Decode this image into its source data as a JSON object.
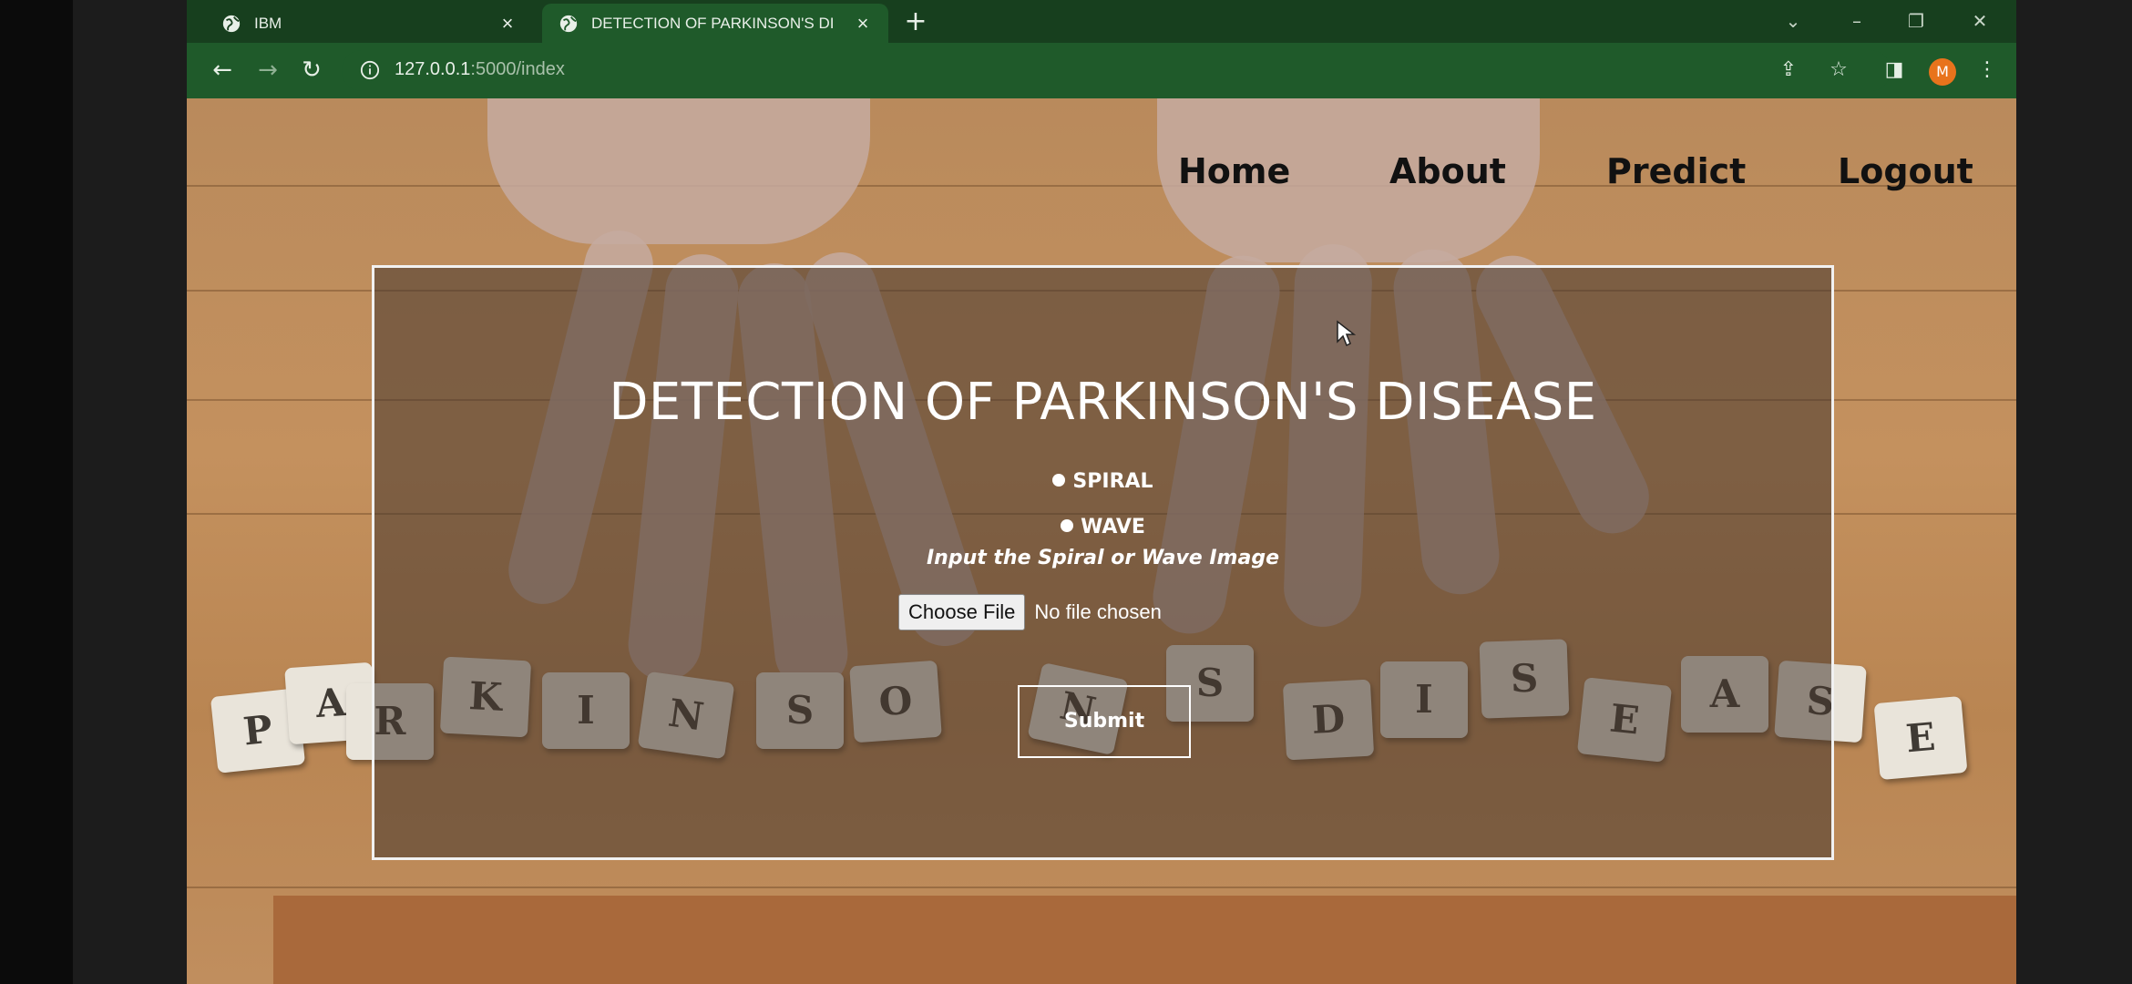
{
  "browser": {
    "tabs": [
      {
        "title": "IBM"
      },
      {
        "title": "DETECTION OF PARKINSON'S DI"
      }
    ],
    "address": {
      "host": "127.0.0.1",
      "path": ":5000/index"
    }
  },
  "nav": {
    "home": "Home",
    "about": "About",
    "predict": "Predict",
    "logout": "Logout"
  },
  "form": {
    "heading": "DETECTION OF PARKINSON'S DISEASE",
    "option_spiral": "SPIRAL",
    "option_wave": "WAVE",
    "instruction": "Input the Spiral or Wave Image",
    "choose_file_label": "Choose File",
    "file_status": "No file chosen",
    "submit_label": "Submit"
  },
  "profile": {
    "initial": "M"
  },
  "background_tiles": [
    "P",
    "A",
    "R",
    "K",
    "I",
    "N",
    "S",
    "O",
    "N",
    "S",
    "D",
    "I",
    "S",
    "E",
    "A",
    "S",
    "E"
  ]
}
